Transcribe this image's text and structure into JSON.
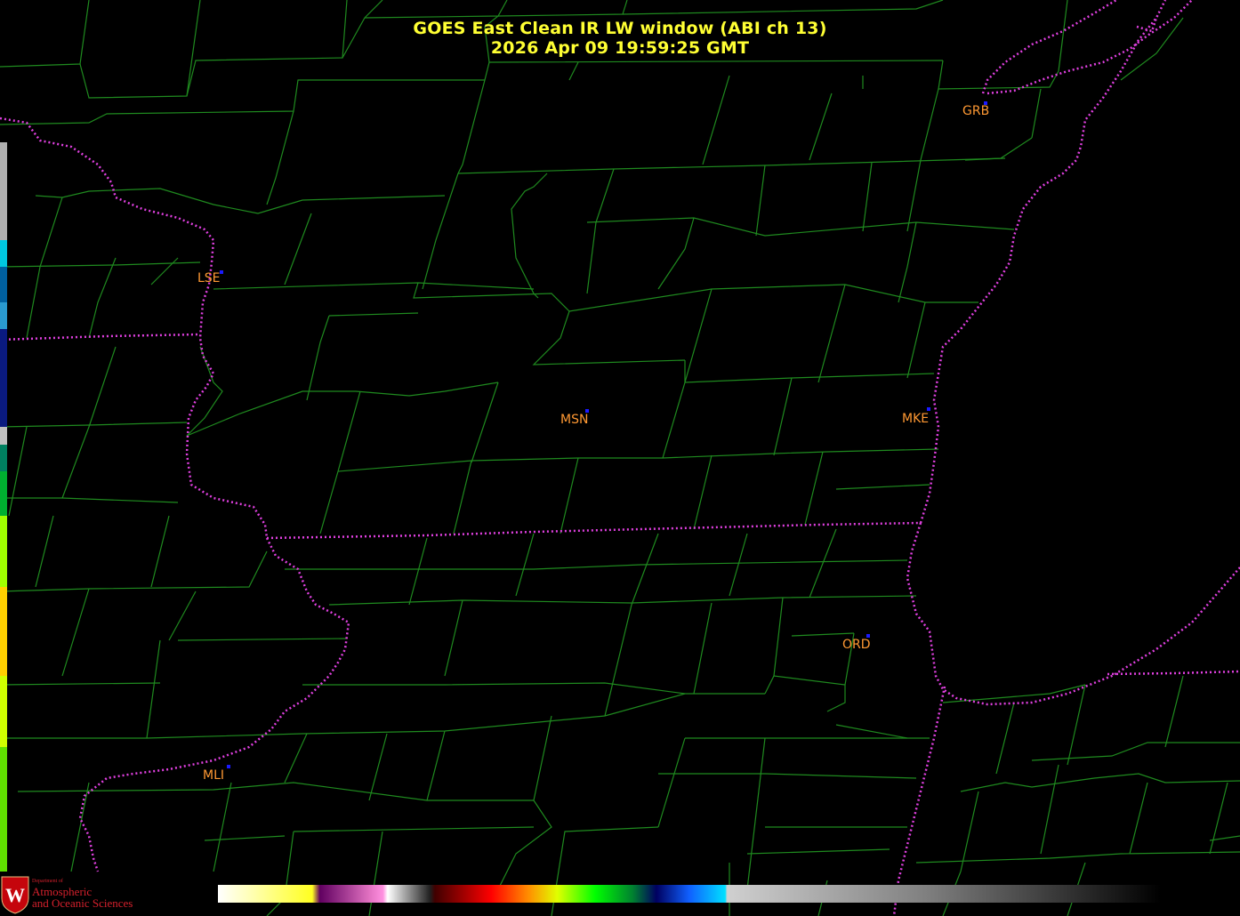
{
  "title": {
    "line1": "GOES East Clean IR LW window (ABI ch 13)",
    "line2": "2026 Apr 09  19:59:25 GMT"
  },
  "stations": [
    {
      "id": "GRB",
      "label": "GRB"
    },
    {
      "id": "LSE",
      "label": "LSE"
    },
    {
      "id": "MSN",
      "label": "MSN"
    },
    {
      "id": "MKE",
      "label": "MKE"
    },
    {
      "id": "ORD",
      "label": "ORD"
    },
    {
      "id": "MLI",
      "label": "MLI"
    }
  ],
  "logo": {
    "dept": "Department of",
    "line1": "Atmospheric",
    "line2": "and Oceanic Sciences",
    "letter": "W"
  },
  "colors": {
    "background": "#000000",
    "county_lines": "#1f8a1f",
    "state_boundary": "#e040e0",
    "title": "#ffff33",
    "station_label": "#ff9933",
    "station_marker": "#1a1aff"
  }
}
